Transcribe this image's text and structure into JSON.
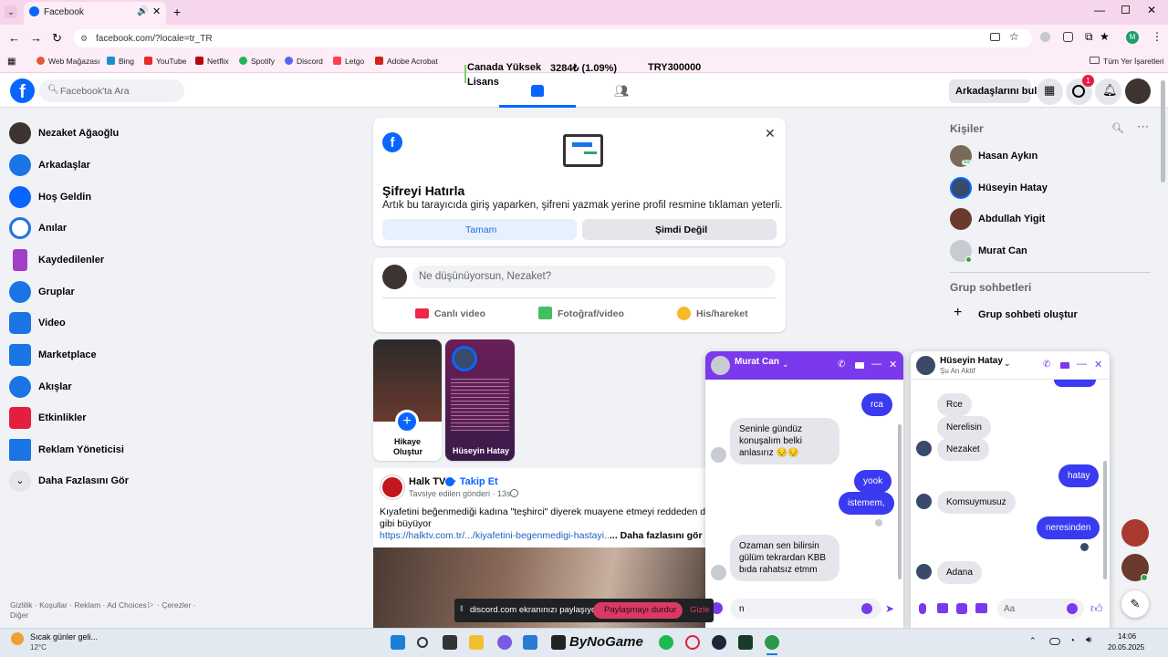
{
  "browser": {
    "tab_title": "Facebook",
    "url": "facebook.com/?locale=tr_TR",
    "profile_initial": "M",
    "bookmarks": [
      "Web Mağazası",
      "Bing",
      "YouTube",
      "Netflix",
      "Spotify",
      "Discord",
      "Letgo",
      "Adobe Acrobat"
    ],
    "all_bookmarks": "Tüm Yer İşaretleri"
  },
  "ticker": {
    "item1": "Canada Yüksek",
    "item1_line2": "Lisans",
    "item2": "3284₺ (1.09%)",
    "item3": "TRY300000"
  },
  "header": {
    "search_placeholder": "Facebook'ta Ara",
    "find_friends": "Arkadaşlarını bul",
    "messenger_badge": "1"
  },
  "left_nav": {
    "items": [
      {
        "label": "Nezaket Ağaoğlu"
      },
      {
        "label": "Arkadaşlar"
      },
      {
        "label": "Hoş Geldin"
      },
      {
        "label": "Anılar"
      },
      {
        "label": "Kaydedilenler"
      },
      {
        "label": "Gruplar"
      },
      {
        "label": "Video"
      },
      {
        "label": "Marketplace"
      },
      {
        "label": "Akışlar"
      },
      {
        "label": "Etkinlikler"
      },
      {
        "label": "Reklam Yöneticisi"
      },
      {
        "label": "Daha Fazlasını Gör"
      }
    ],
    "footer_line1": "Gizlilik · Koşullar · Reklam · Ad Choices",
    "footer_cookies": "· Çerezler ·",
    "footer_line2": "Diğer"
  },
  "password_card": {
    "title": "Şifreyi Hatırla",
    "body": "Artık bu tarayıcıda giriş yaparken, şifreni yazmak yerine profil resmine tıklaman yeterli.",
    "ok_button": "Tamam",
    "not_now_button": "Şimdi Değil"
  },
  "composer": {
    "placeholder": "Ne düşünüyorsun, Nezaket?",
    "live_video": "Canlı video",
    "photo_video": "Fotoğraf/video",
    "feeling": "His/hareket"
  },
  "stories": {
    "create_label_1": "Hikaye",
    "create_label_2": "Oluştur",
    "story_name": "Hüseyin Hatay"
  },
  "post": {
    "page_name": "Halk TV",
    "follow": "· Takip Et",
    "meta": "Tavsiye edilen gönderi · 13s ·",
    "text_line1": "Kıyafetini beğenmediği kadına \"teşhirci\" diyerek muayene etmeyi reddeden doktor",
    "text_line2": "gibi büyüyor",
    "link": "https://halktv.com.tr/.../kiyafetini-begenmedigi-hastayi...",
    "see_more": "... Daha fazlasını gör"
  },
  "contacts": {
    "heading": "Kişiler",
    "people": [
      {
        "name": "Hasan Aykın",
        "status": "6d"
      },
      {
        "name": "Hüseyin Hatay"
      },
      {
        "name": "Abdullah Yigit"
      },
      {
        "name": "Murat Can"
      }
    ],
    "groups_heading": "Grup sohbetleri",
    "create_group": "Grup sohbeti oluştur"
  },
  "chat_murat": {
    "name": "Murat Can",
    "messages": [
      {
        "from": "me",
        "text": "rca"
      },
      {
        "from": "them",
        "text": "Seninle gündüz konuşalım belki anlasırız 😔😔"
      },
      {
        "from": "me",
        "text": "yook"
      },
      {
        "from": "me",
        "text": "istemem,"
      },
      {
        "from": "them",
        "text": "Ozaman sen bilirsin gülüm tekrardan KBB bıda rahatsız etmm"
      }
    ],
    "input_value": "n"
  },
  "chat_huseyin": {
    "name": "Hüseyin Hatay",
    "status": "Şu An Aktif",
    "messages": [
      {
        "from": "them",
        "text": "Rce"
      },
      {
        "from": "them",
        "text": "Nerelisin"
      },
      {
        "from": "them",
        "text": "Nezaket"
      },
      {
        "from": "me",
        "text": "hatay"
      },
      {
        "from": "them",
        "text": "Komsuymusuz"
      },
      {
        "from": "me",
        "text": "neresinden"
      },
      {
        "from": "them",
        "text": "Adana"
      }
    ],
    "input_placeholder": "Aa"
  },
  "share_banner": {
    "text": "discord.com ekranınızı paylaşıyor.",
    "stop_button": "Paylaşmayı durdur",
    "hide_link": "Gizle"
  },
  "taskbar": {
    "weather_title": "Sıcak günler geli...",
    "temp": "12°C",
    "clock_time": "14:06",
    "clock_date": "20.05.2025",
    "app_label": "ByNoGame"
  },
  "colors": {
    "fb_blue": "#0866ff",
    "messenger_purple": "#7b39ed",
    "out_bubble": "#3a3af0"
  }
}
